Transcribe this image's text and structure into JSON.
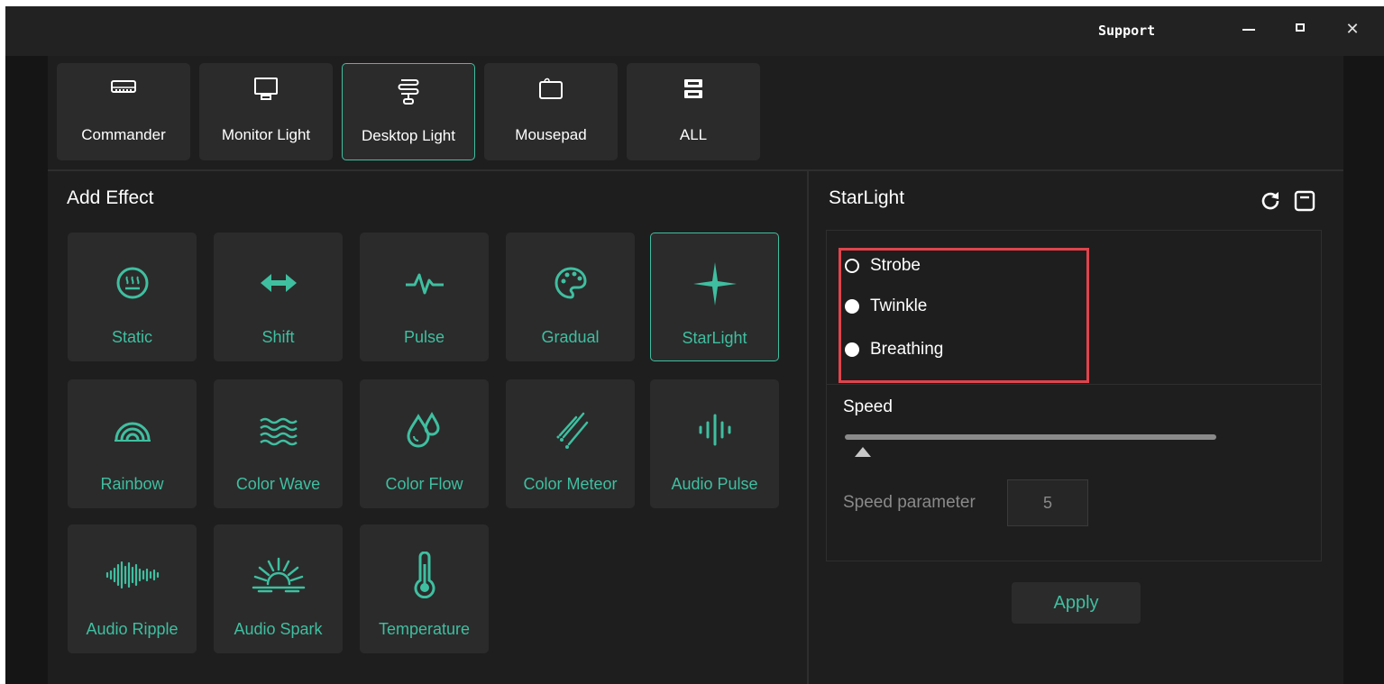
{
  "window": {
    "support_label": "Support",
    "close_glyph": "✕"
  },
  "devices": [
    {
      "label": "Commander",
      "icon": "commander-icon"
    },
    {
      "label": "Monitor Light",
      "icon": "monitor-icon"
    },
    {
      "label": "Desktop Light",
      "icon": "desktop-light-icon",
      "selected": true
    },
    {
      "label": "Mousepad",
      "icon": "mousepad-icon"
    },
    {
      "label": "ALL",
      "icon": "all-devices-icon"
    }
  ],
  "add_effect": {
    "title": "Add Effect",
    "effects": [
      {
        "label": "Static",
        "icon": "static-icon"
      },
      {
        "label": "Shift",
        "icon": "shift-icon"
      },
      {
        "label": "Pulse",
        "icon": "pulse-icon"
      },
      {
        "label": "Gradual",
        "icon": "palette-icon"
      },
      {
        "label": "StarLight",
        "icon": "starlight-icon",
        "selected": true
      },
      {
        "label": "Rainbow",
        "icon": "rainbow-icon"
      },
      {
        "label": "Color Wave",
        "icon": "color-wave-icon"
      },
      {
        "label": "Color Flow",
        "icon": "color-flow-icon"
      },
      {
        "label": "Color Meteor",
        "icon": "color-meteor-icon"
      },
      {
        "label": "Audio Pulse",
        "icon": "audio-pulse-icon"
      },
      {
        "label": "Audio Ripple",
        "icon": "audio-ripple-icon"
      },
      {
        "label": "Audio Spark",
        "icon": "audio-spark-icon"
      },
      {
        "label": "Temperature",
        "icon": "thermometer-icon"
      }
    ]
  },
  "settings": {
    "title": "StarLight",
    "modes": [
      {
        "label": "Strobe",
        "selected": true
      },
      {
        "label": "Twinkle",
        "selected": false
      },
      {
        "label": "Breathing",
        "selected": false
      }
    ],
    "speed_label": "Speed",
    "speed_param_label": "Speed parameter",
    "speed_value": "5",
    "apply_label": "Apply"
  },
  "colors": {
    "accent": "#3fbfa0",
    "highlight_box": "#e0444c",
    "panel": "#2b2b2b",
    "background": "#1e1e1e"
  }
}
